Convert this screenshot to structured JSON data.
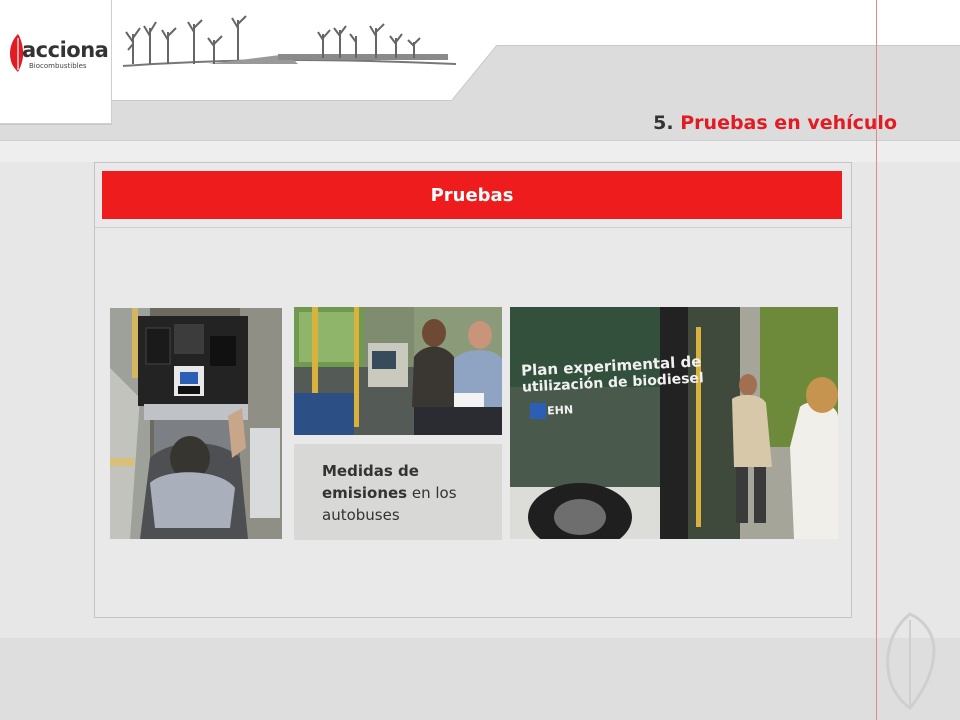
{
  "logo": {
    "name": "acciona",
    "subtitle": "Biocombustibles"
  },
  "header": {
    "section_number": "5.",
    "section_title": "Pruebas en vehículo"
  },
  "card": {
    "title": "Pruebas"
  },
  "caption": {
    "bold_text": "Medidas de emisiones",
    "normal_text": " en los autobuses"
  },
  "photos": [
    {
      "name": "photo-measuring-equipment",
      "description_icon": "technician-with-equipment"
    },
    {
      "name": "photo-bus-interior",
      "description_icon": "passengers-inside-bus"
    },
    {
      "name": "photo-bus-exterior",
      "description_icon": "bus-door-boarding"
    }
  ],
  "bus_sign": {
    "line1": "Plan experimental de",
    "line2": "utilización de biodiesel",
    "brand": "EHN"
  },
  "colors": {
    "accent_red": "#ee1c1c",
    "title_red": "#e31b23",
    "text_dark": "#333333"
  }
}
